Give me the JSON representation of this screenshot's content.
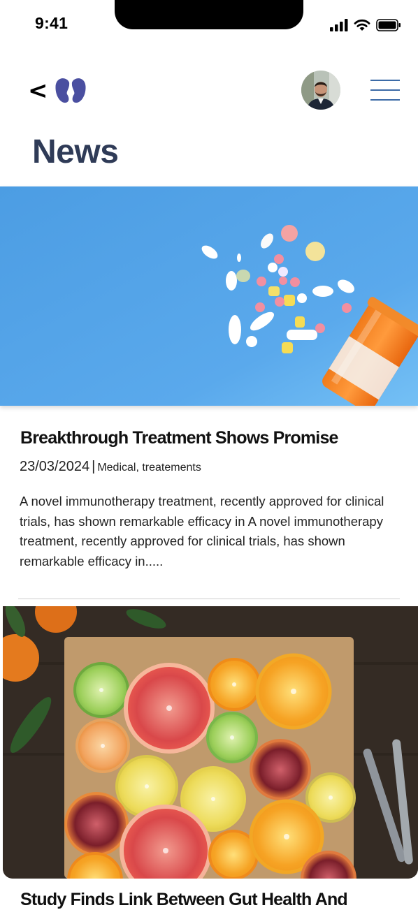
{
  "status_bar": {
    "time": "9:41"
  },
  "header": {
    "back_label": "<"
  },
  "page": {
    "title": "News"
  },
  "articles": [
    {
      "title": "Breakthrough Treatment Shows Promise",
      "date": "23/03/2024",
      "separator": "|",
      "categories": "Medical, treatements",
      "excerpt": "A novel immunotherapy treatment, recently approved for clinical trials, has shown remarkable efficacy in A novel immunotherapy treatment, recently approved for clinical trials, has shown remarkable efficacy in....."
    },
    {
      "title": "Study Finds Link Between Gut Health And"
    }
  ],
  "icons": {
    "back": "chevron-left-icon",
    "logo": "kidney-logo-icon",
    "menu": "hamburger-menu-icon",
    "signal": "cellular-signal-icon",
    "wifi": "wifi-icon",
    "battery": "battery-icon"
  },
  "colors": {
    "title": "#2f3b57",
    "logo": "#4a4fa0",
    "menu": "#3c6ba7",
    "hero_bg": "#5aa7e6"
  }
}
